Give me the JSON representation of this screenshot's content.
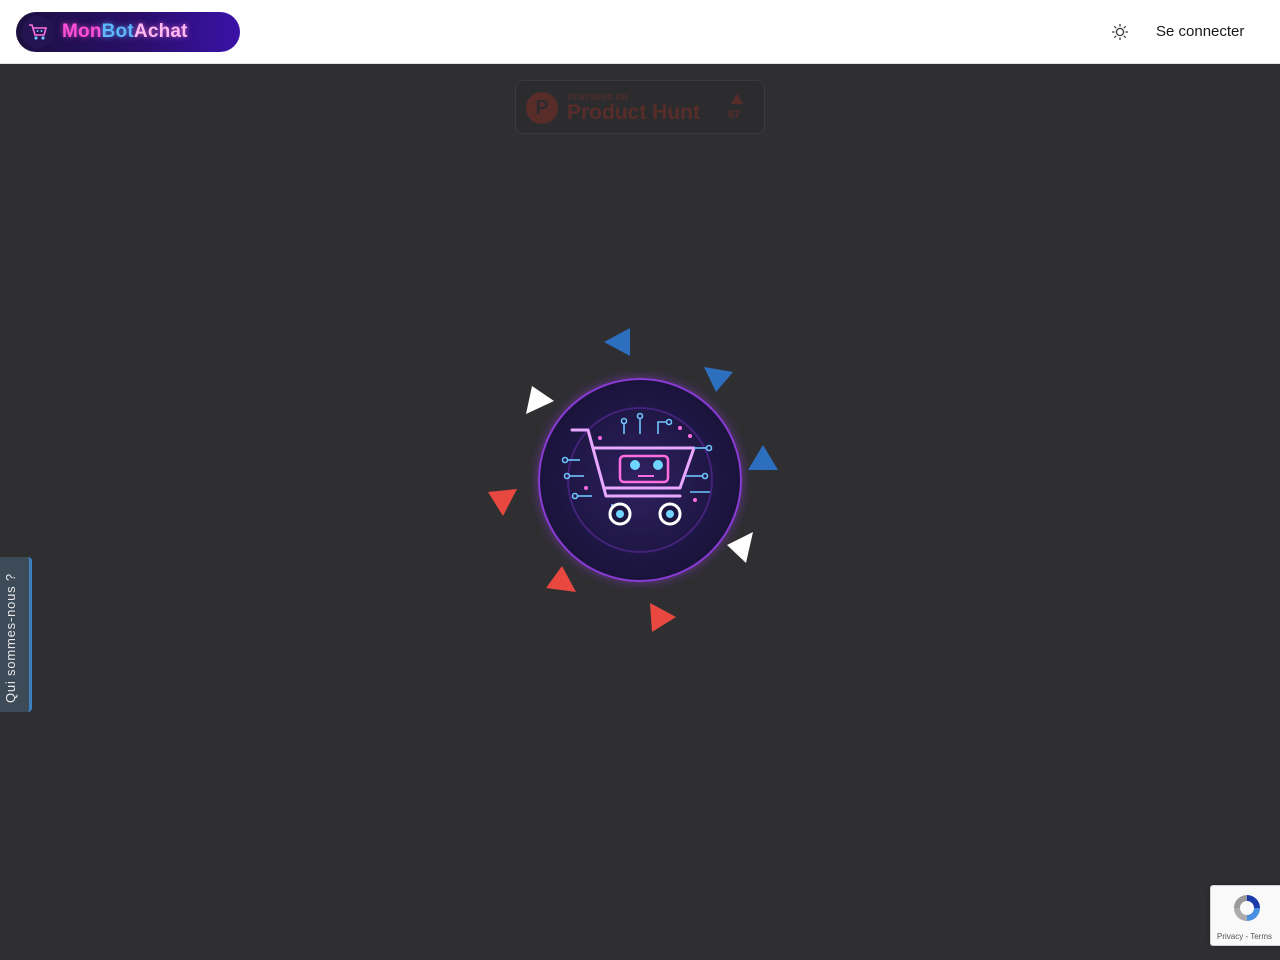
{
  "header": {
    "logo": {
      "part1": "Mon",
      "part2": "Bot",
      "part3": "Achat"
    },
    "theme_toggle_icon": "sun-icon",
    "login_label": "Se connecter"
  },
  "product_hunt_badge": {
    "featured_label": "FEATURED ON",
    "name": "Product Hunt",
    "logo_letter": "P",
    "upvotes": "87",
    "upvote_icon": "triangle-up-icon"
  },
  "loader": {
    "center_icon": "robot-shopping-cart-icon",
    "triangle_colors": [
      "#2d6fbf",
      "#ffffff",
      "#e8483f"
    ]
  },
  "side_tab": {
    "label": "Qui sommes-nous ?"
  },
  "recaptcha": {
    "privacy": "Privacy",
    "separator": "-",
    "terms": "Terms"
  },
  "colors": {
    "background": "#2f2f32",
    "header_bg": "#ffffff",
    "accent_purple": "#8a3bd6",
    "accent_blue": "#2d6fbf",
    "accent_red": "#e8483f"
  }
}
